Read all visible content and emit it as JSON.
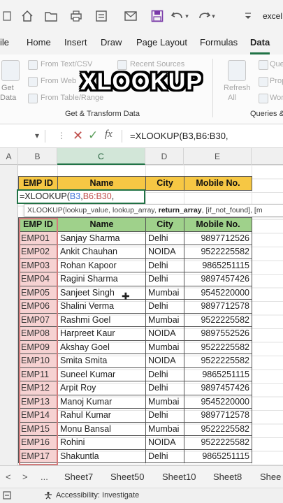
{
  "qat": {
    "title": "excel",
    "ribbon_options_icon": "ribbon-options-icon",
    "icons": [
      "home-icon",
      "undo-icon",
      "redo-icon",
      "save-icon",
      "customize-qat-icon"
    ]
  },
  "tabs": [
    {
      "label": "ile"
    },
    {
      "label": "Home"
    },
    {
      "label": "Insert"
    },
    {
      "label": "Draw"
    },
    {
      "label": "Page Layout"
    },
    {
      "label": "Formulas"
    },
    {
      "label": "Data",
      "active": true
    }
  ],
  "ribbon": {
    "get_label": "Get",
    "data_label": "Data",
    "from_text_csv": "From Text/CSV",
    "from_web": "From Web",
    "from_table_range": "From Table/Range",
    "recent_sources": "Recent Sources",
    "refresh": "Refresh",
    "all": "All",
    "que": "Que",
    "pro": "Prop",
    "wor": "Wor",
    "group_get_transform": "Get & Transform Data",
    "group_queries": "Queries &"
  },
  "overlay_title": "XLOOKUP",
  "formula_bar": {
    "text": "=XLOOKUP(B3,B6:B30,"
  },
  "columns": [
    "A",
    "B",
    "C",
    "D",
    "E"
  ],
  "lookup_table": {
    "headers": [
      "EMP ID",
      "Name",
      "City",
      "Mobile No."
    ]
  },
  "active_cell": {
    "prefix": "=XLOOKUP(",
    "ref1": "B3",
    "comma": ",",
    "ref2": "B6:B30",
    "suffix": ","
  },
  "tooltip": {
    "fn": "XLOOKUP(",
    "args": "lookup_value, lookup_array, ",
    "current": "return_array",
    "rest": ", [if_not_found], [m"
  },
  "main_table": {
    "headers": [
      "EMP ID",
      "Name",
      "City",
      "Mobile No."
    ],
    "rows": [
      [
        "EMP01",
        "Sanjay Sharma",
        "Delhi",
        "9897712526"
      ],
      [
        "EMP02",
        "Ankit Chauhan",
        "NOIDA",
        "9522225582"
      ],
      [
        "EMP03",
        "Rohan Kapoor",
        "Delhi",
        "9865251115"
      ],
      [
        "EMP04",
        "Ragini Sharma",
        "Delhi",
        "9897457426"
      ],
      [
        "EMP05",
        "Sanjeet Singh",
        "Mumbai",
        "9545220000"
      ],
      [
        "EMP06",
        "Shalini Verma",
        "Delhi",
        "9897712578"
      ],
      [
        "EMP07",
        "Rashmi Goel",
        "Mumbai",
        "9522225582"
      ],
      [
        "EMP08",
        "Harpreet Kaur",
        "NOIDA",
        "9897552526"
      ],
      [
        "EMP09",
        "Akshay Goel",
        "Mumbai",
        "9522225582"
      ],
      [
        "EMP10",
        "Smita Smita",
        "NOIDA",
        "9522225582"
      ],
      [
        "EMP11",
        "Suneel Kumar",
        "Delhi",
        "9865251115"
      ],
      [
        "EMP12",
        "Arpit Roy",
        "Delhi",
        "9897457426"
      ],
      [
        "EMP13",
        "Manoj Kumar",
        "Mumbai",
        "9545220000"
      ],
      [
        "EMP14",
        "Rahul Kumar",
        "Delhi",
        "9897712578"
      ],
      [
        "EMP15",
        "Monu Bansal",
        "Mumbai",
        "9522225582"
      ],
      [
        "EMP16",
        "Rohini",
        "NOIDA",
        "9522225582"
      ],
      [
        "EMP17",
        "Shakuntla",
        "Delhi",
        "9865251115"
      ]
    ]
  },
  "sheet_tabs": {
    "prev": "<",
    "next": ">",
    "more": "...",
    "sheets": [
      "Sheet7",
      "Sheet50",
      "Sheet10",
      "Sheet8",
      "Shee"
    ]
  },
  "status": {
    "accessibility": "Accessibility: Investigate"
  },
  "colors": {
    "accent": "#217346",
    "header_yellow": "#f6c744",
    "header_green": "#9fd18b",
    "emp_fill": "#f6d2d2"
  }
}
